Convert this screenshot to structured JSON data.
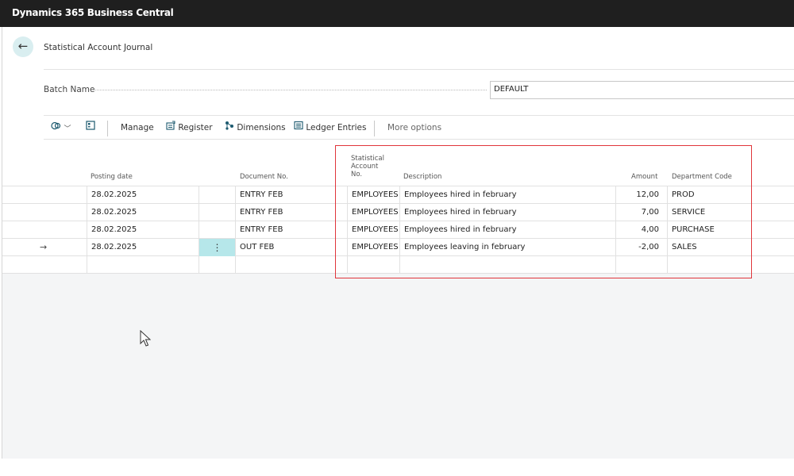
{
  "app": {
    "title": "Dynamics 365 Business Central"
  },
  "page": {
    "title": "Statistical Account Journal"
  },
  "batch": {
    "label": "Batch Name",
    "value": "DEFAULT"
  },
  "toolbar": {
    "manage": "Manage",
    "register": "Register",
    "dimensions": "Dimensions",
    "ledger_entries": "Ledger Entries",
    "more_options": "More options"
  },
  "table": {
    "headers": {
      "posting_date": "Posting date",
      "document_no": "Document No.",
      "stat_account_line1": "Statistical",
      "stat_account_line2": "Account",
      "stat_account_line3": "No.",
      "description": "Description",
      "amount": "Amount",
      "department_code": "Department Code"
    },
    "rows": [
      {
        "posting_date": "28.02.2025",
        "document_no": "ENTRY FEB",
        "stat_account_no": "EMPLOYEES",
        "description": "Employees hired in february",
        "amount": "12,00",
        "department_code": "PROD"
      },
      {
        "posting_date": "28.02.2025",
        "document_no": "ENTRY FEB",
        "stat_account_no": "EMPLOYEES",
        "description": "Employees hired in february",
        "amount": "7,00",
        "department_code": "SERVICE"
      },
      {
        "posting_date": "28.02.2025",
        "document_no": "ENTRY FEB",
        "stat_account_no": "EMPLOYEES",
        "description": "Employees hired in february",
        "amount": "4,00",
        "department_code": "PURCHASE"
      },
      {
        "posting_date": "28.02.2025",
        "document_no": "OUT FEB",
        "stat_account_no": "EMPLOYEES",
        "description": "Employees leaving in february",
        "amount": "-2,00",
        "department_code": "SALES"
      }
    ],
    "current_row_marker": "→",
    "row_menu_glyph": "⋮"
  },
  "icons": {
    "back": "back-arrow-icon",
    "copilot": "copilot-icon",
    "chevron": "chevron-down-icon",
    "edit_list": "edit-list-icon",
    "register": "register-icon",
    "dimensions": "dimensions-icon",
    "ledger": "ledger-entries-icon",
    "cursor": "mouse-pointer-icon"
  },
  "colors": {
    "topbar": "#1f1f1f",
    "accent": "#b6e7ea",
    "highlight_border": "#e0353b",
    "grey_area": "#f4f5f6"
  }
}
